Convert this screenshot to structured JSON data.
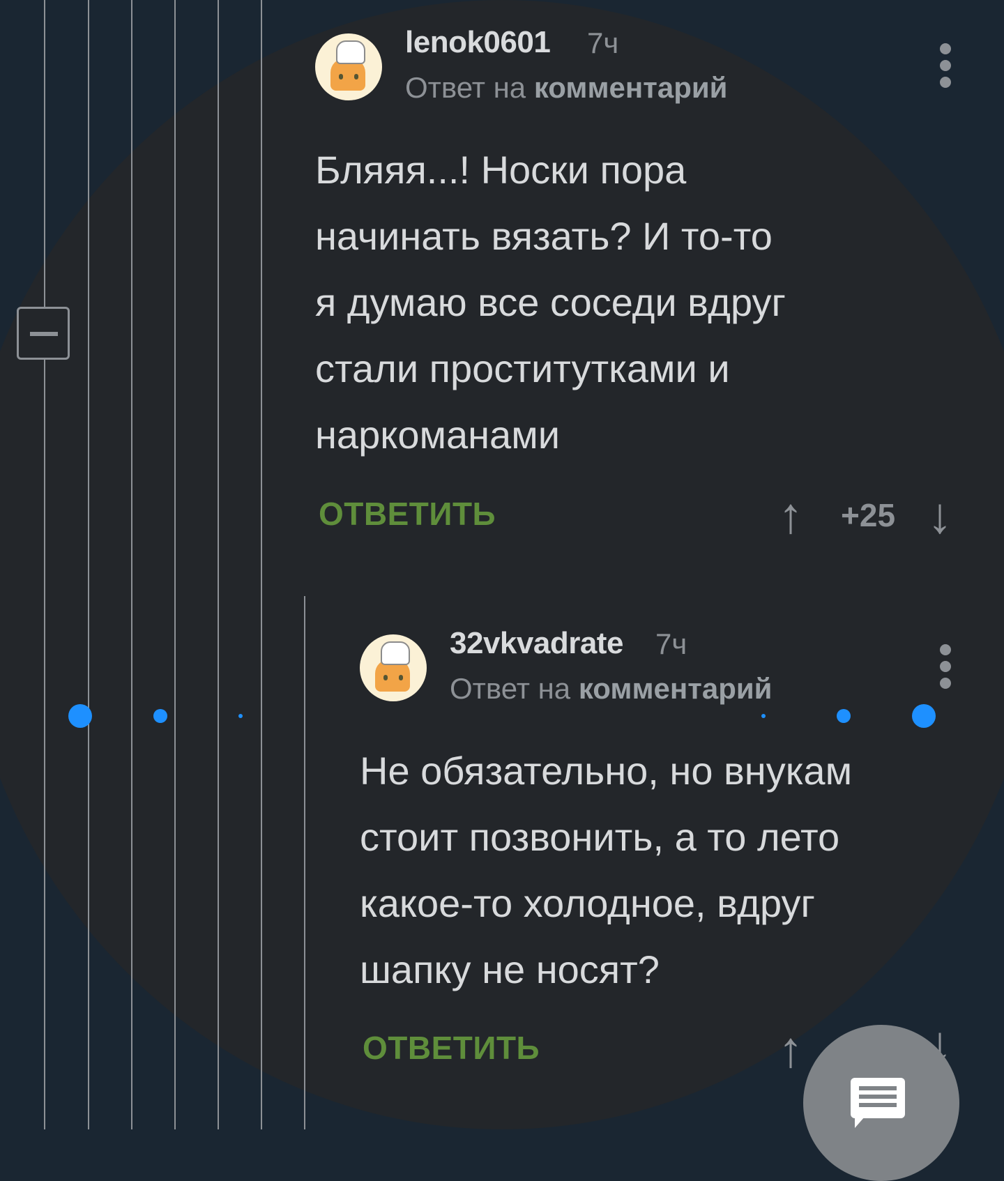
{
  "comment1": {
    "username": "lenok0601",
    "time": "7ч",
    "reply_prefix": "Ответ на",
    "reply_target": "комментарий",
    "text": "Бляяя...! Носки пора\nначинать вязать? И то-то\nя думаю все соседи вдруг\nстали проститутками и\nнаркоманами",
    "reply_label": "ОТВЕТИТЬ",
    "score": "+25"
  },
  "comment2": {
    "username": "32vkvadrate",
    "time": "7ч",
    "reply_prefix": "Ответ на",
    "reply_target": "комментарий",
    "text": "Не обязательно, но внукам\nстоит позвонить, а то лето\nкакое-то холодное, вдруг\nшапку не носят?",
    "reply_label": "ОТВЕТИТЬ"
  },
  "icons": {
    "upvote": "↑",
    "downvote": "↓",
    "collapse": "minus-square-icon",
    "menu": "more-vertical-icon",
    "fab": "comment-icon"
  },
  "colors": {
    "accent_green": "#5f8e3b",
    "dot_blue": "#1e90ff",
    "background": "#23262a"
  }
}
